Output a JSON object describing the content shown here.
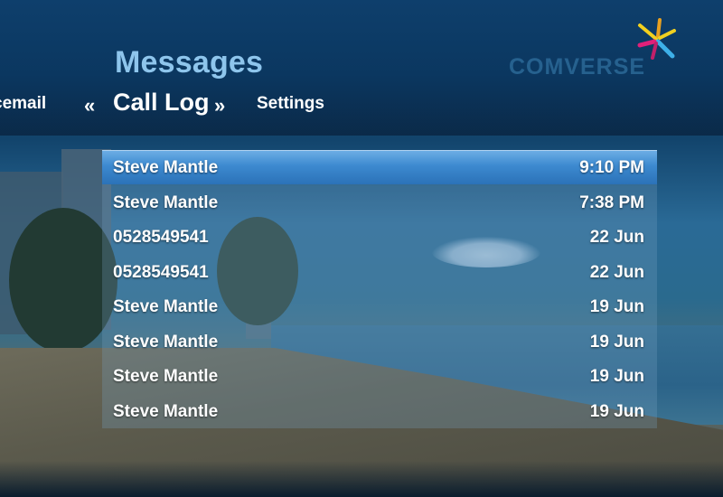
{
  "header": {
    "title": "Messages",
    "brand": "COMVERSE"
  },
  "nav": {
    "prev_label": "Voicemail",
    "prev_visible": "cemail",
    "left_arrow": "«",
    "current_label": "Call Log",
    "right_arrow": "»",
    "next_label": "Settings"
  },
  "call_log": [
    {
      "caller": "Steve Mantle",
      "time": "9:10 PM",
      "selected": true
    },
    {
      "caller": "Steve Mantle",
      "time": "7:38 PM",
      "selected": false
    },
    {
      "caller": "0528549541",
      "time": "22 Jun",
      "selected": false
    },
    {
      "caller": "0528549541",
      "time": "22 Jun",
      "selected": false
    },
    {
      "caller": "Steve Mantle",
      "time": "19 Jun",
      "selected": false
    },
    {
      "caller": "Steve Mantle",
      "time": "19 Jun",
      "selected": false
    },
    {
      "caller": "Steve Mantle",
      "time": "19 Jun",
      "selected": false
    },
    {
      "caller": "Steve Mantle",
      "time": "19 Jun",
      "selected": false
    }
  ],
  "colors": {
    "title": "#8ec5ec",
    "selection": "#3d8ad0",
    "text": "#ffffff"
  },
  "icons": {
    "logo": "comverse-logo-icon"
  }
}
